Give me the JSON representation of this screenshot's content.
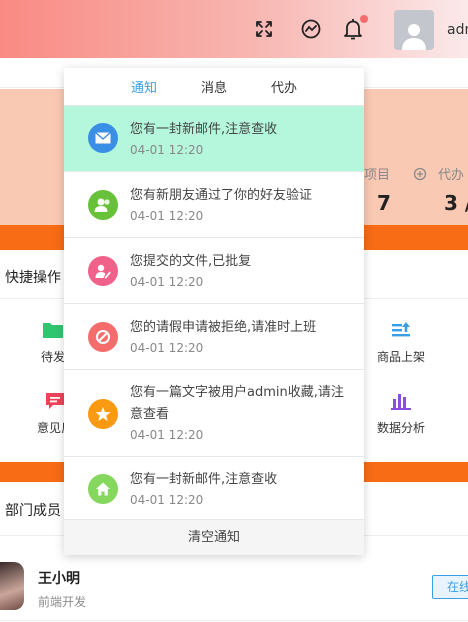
{
  "header": {
    "user_name": "admin",
    "icons": [
      "fullscreen-icon",
      "theme-icon",
      "bell-icon",
      "user-avatar"
    ],
    "colors": {
      "gradient_start": "#f98a83",
      "gradient_end": "#fbe9ea",
      "badge": "#f56c6c"
    }
  },
  "stats": [
    {
      "label": "项目",
      "value": "7",
      "icon": "none"
    },
    {
      "label": "代办",
      "value": "3 /",
      "icon": "task-icon"
    }
  ],
  "quick_actions": {
    "title": "快捷操作",
    "items": [
      {
        "label": "待发",
        "icon": "folder-icon",
        "color": "#2ec770"
      },
      {
        "label": "商品上架",
        "icon": "upload-list-icon",
        "color": "#3a9ee4"
      },
      {
        "label": "意见反",
        "icon": "message-icon",
        "color": "#f0435a"
      },
      {
        "label": "数据分析",
        "icon": "bar-chart-icon",
        "color": "#8a4de0"
      }
    ]
  },
  "members": {
    "title": "部门成员",
    "list": [
      {
        "name": "王小明",
        "role": "前端开发",
        "status": "在线"
      }
    ]
  },
  "dropdown": {
    "tabs": [
      "通知",
      "消息",
      "代办"
    ],
    "active_tab": "通知",
    "notifications": [
      {
        "text": "您有一封新邮件,注意查收",
        "time": "04-01 12:20",
        "icon": "mail-icon",
        "color": "#3a8ee6",
        "highlight": true
      },
      {
        "text": "您有新朋友通过了你的好友验证",
        "time": "04-01 12:20",
        "icon": "friends-icon",
        "color": "#67c23a",
        "highlight": false
      },
      {
        "text": "您提交的文件,已批复",
        "time": "04-01 12:20",
        "icon": "file-approve-icon",
        "color": "#f0628a",
        "highlight": false
      },
      {
        "text": "您的请假申请被拒绝,请准时上班",
        "time": "04-01 12:20",
        "icon": "reject-icon",
        "color": "#f56c6c",
        "highlight": false
      },
      {
        "text": "您有一篇文字被用户admin收藏,请注意查看",
        "time": "04-01 12:20",
        "icon": "star-icon",
        "color": "#fa9a12",
        "highlight": false
      },
      {
        "text": "您有一封新邮件,注意查收",
        "time": "04-01 12:20",
        "icon": "home-icon",
        "color": "#85d75d",
        "highlight": false
      }
    ],
    "clear_label": "清空通知"
  }
}
